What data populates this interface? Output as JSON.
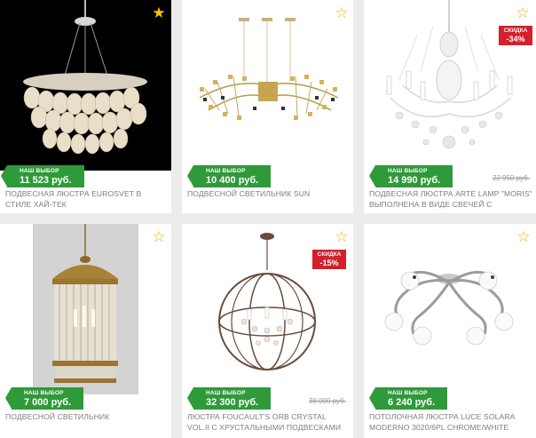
{
  "labels": {
    "choice": "НАШ ВЫБОР",
    "discount": "СКИДКА"
  },
  "products": [
    {
      "title": "ПОДВЕСНАЯ ЛЮСТРА EUROSVET В СТИЛЕ ХАЙ-ТЕК",
      "price": "11 523 руб."
    },
    {
      "title": "ПОДВЕСНОЙ СВЕТИЛЬНИК SUN",
      "price": "10 400 руб."
    },
    {
      "title": "ПОДВЕСНАЯ ЛЮСТРА ARTE LAMP \"MORIS\" ВЫПОЛНЕНА В ВИДЕ СВЕЧЕЙ С",
      "price": "14 990 руб.",
      "old_price": "22 950 руб.",
      "discount": "-34%"
    },
    {
      "title": "ПОДВЕСНОЙ СВЕТИЛЬНИК",
      "price": "7 000 руб."
    },
    {
      "title": "ЛЮСТРА FOUCAULT'S ORB CRYSTAL VOL.II С ХРУСТАЛЬНЫМИ ПОДВЕСКАМИ",
      "price": "32 300 руб.",
      "old_price": "38 000 руб.",
      "discount": "-15%"
    },
    {
      "title": "ПОТОЛОЧНАЯ ЛЮСТРА LUCE SOLARA MODERNO 3020/6PL CHROME/WHITE",
      "price": "6 240 руб."
    }
  ],
  "colors": {
    "badge_green": "#2f9a3a",
    "sale_red": "#d4202a",
    "star": "#f0b400"
  }
}
